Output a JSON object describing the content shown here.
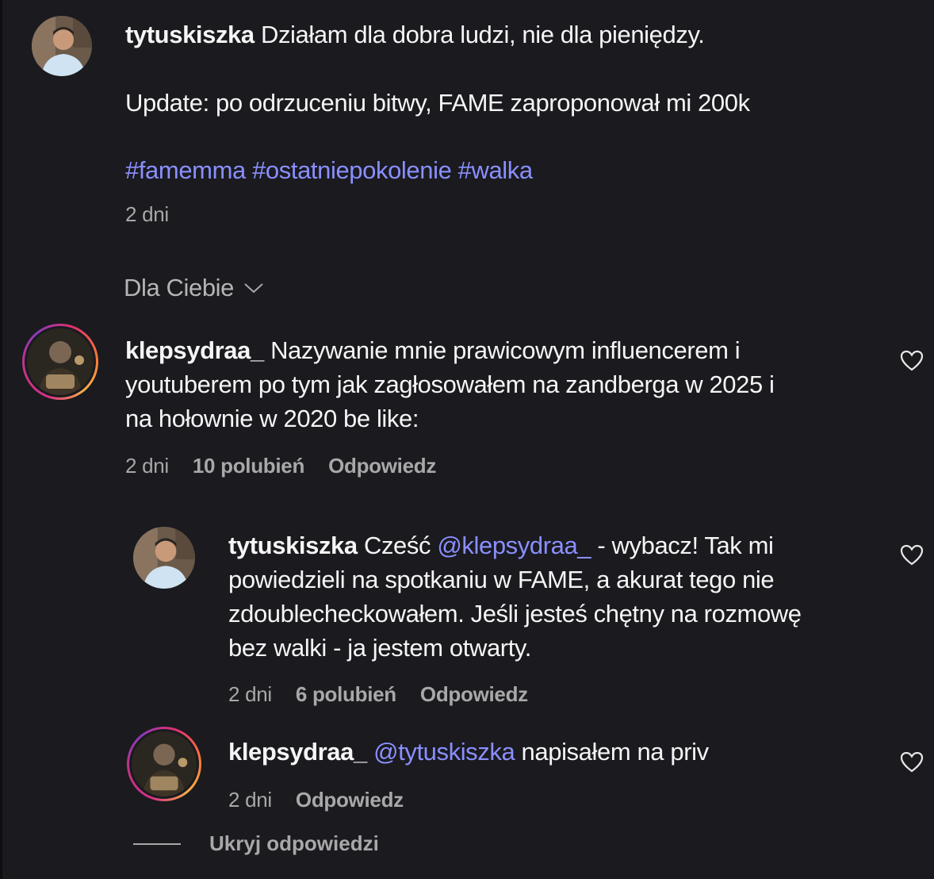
{
  "post": {
    "username": "tytuskiszka",
    "text_line1": "Działam dla dobra ludzi, nie dla pieniędzy.",
    "text_line2": "Update: po odrzuceniu bitwy, FAME zaproponował mi 200k",
    "hashtags": [
      "#famemma",
      "#ostatniepokolenie",
      "#walka"
    ],
    "time": "2 dni"
  },
  "sort": {
    "label": "Dla Ciebie",
    "icon": "chevron-down-icon"
  },
  "comments": [
    {
      "username": "klepsydraa_",
      "lines": [
        "Nazywanie mnie prawicowym influencerem i",
        "youtuberem po tym jak zagłosowałem na zandberga w 2025 i",
        "na hołownie w 2020 be like:"
      ],
      "time": "2 dni",
      "likes": "10 polubień",
      "reply_label": "Odpowiedz"
    }
  ],
  "replies": [
    {
      "username": "tytuskiszka",
      "line1_prefix": "Cześć",
      "mention": "@klepsydraa_",
      "line1_suffix": "- wybacz! Tak mi",
      "lines": [
        "powiedzieli na spotkaniu w FAME, a akurat tego nie",
        "zdoublecheckowałem. Jeśli jesteś chętny na rozmowę",
        "bez walki - ja jestem otwarty."
      ],
      "time": "2 dni",
      "likes": "6 polubień",
      "reply_label": "Odpowiedz"
    },
    {
      "username": "klepsydraa_",
      "mention": "@tytuskiszka",
      "text": "napisałem na priv",
      "time": "2 dni",
      "reply_label": "Odpowiedz"
    }
  ],
  "hide_replies_label": "Ukryj odpowiedzi",
  "colors": {
    "background": "#1a1a1f",
    "link": "#8a8fff",
    "muted": "#a8a8a8"
  }
}
